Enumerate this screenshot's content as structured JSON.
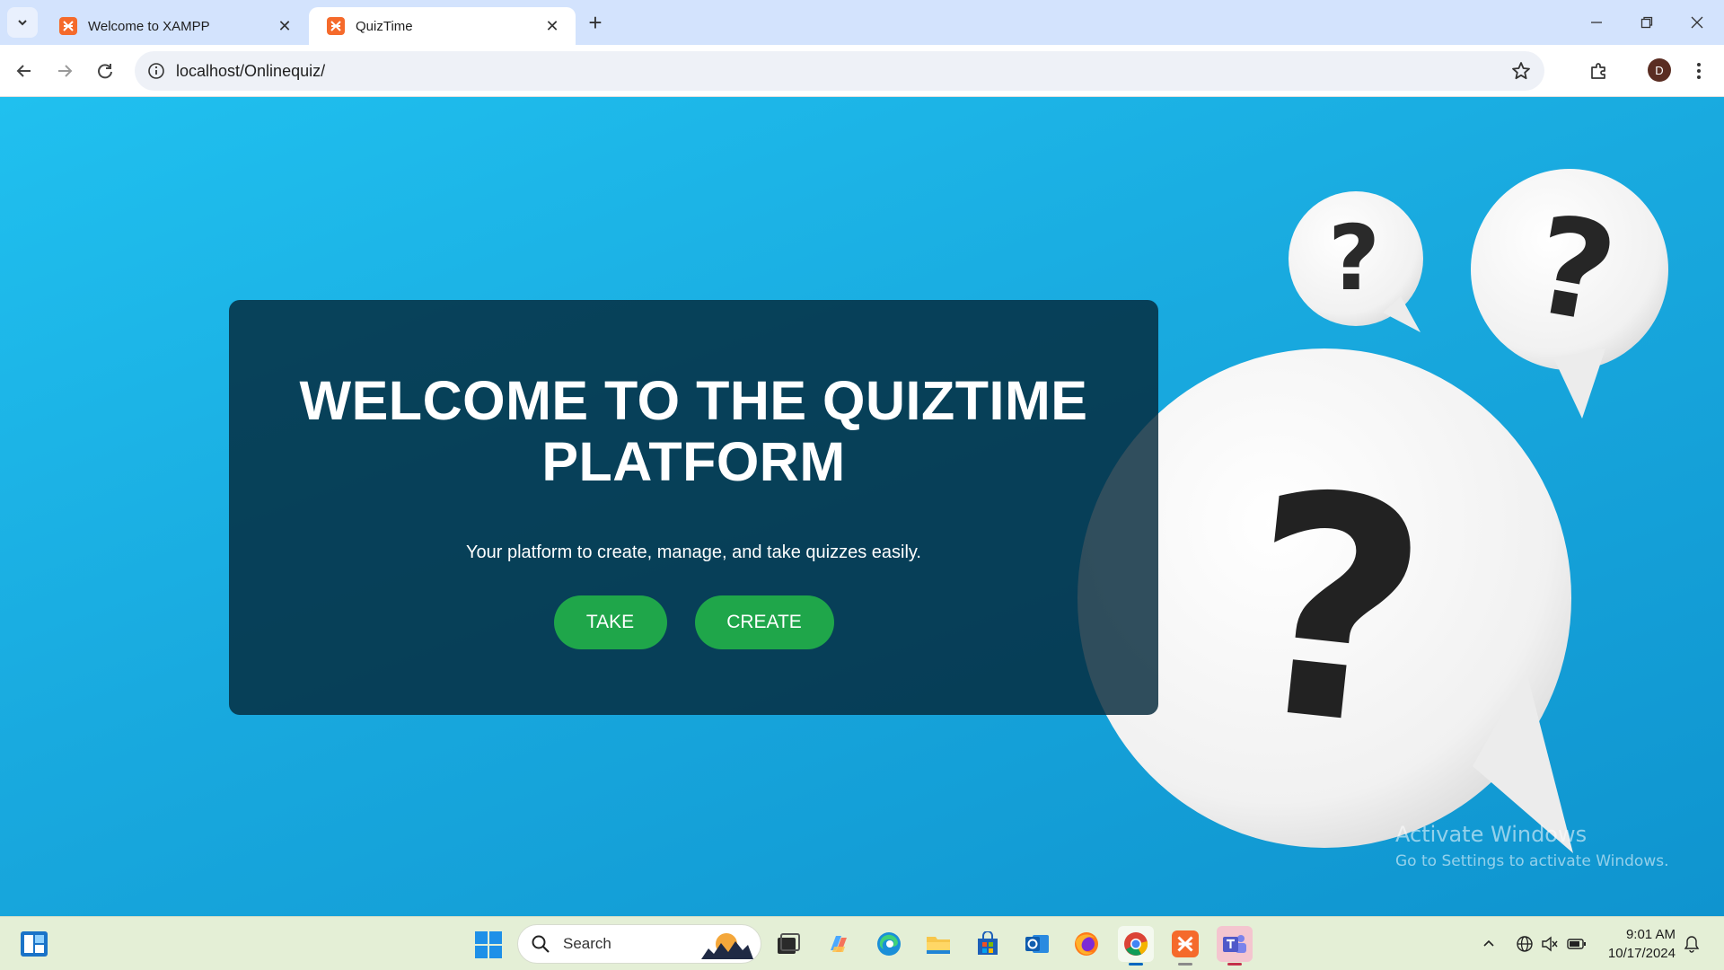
{
  "browser": {
    "tabs": [
      {
        "title": "Welcome to XAMPP",
        "active": false,
        "favicon": "xampp-icon"
      },
      {
        "title": "QuizTime",
        "active": true,
        "favicon": "xampp-icon"
      }
    ],
    "url": "localhost/Onlinequiz/",
    "profile_initial": "D"
  },
  "page": {
    "title": "WELCOME TO THE QUIZTIME PLATFORM",
    "subtitle": "Your platform to create, manage, and take quizzes easily.",
    "buttons": {
      "take": "TAKE",
      "create": "CREATE"
    },
    "button_color": "#1fa64a",
    "background_color": "#19aadf",
    "background_art": "question-mark-speech-bubbles"
  },
  "watermark": {
    "line1": "Activate Windows",
    "line2": "Go to Settings to activate Windows."
  },
  "taskbar": {
    "search_label": "Search",
    "apps": [
      "task-view-icon",
      "copilot-icon",
      "edge-icon",
      "file-explorer-icon",
      "store-icon",
      "outlook-icon",
      "firefox-icon",
      "chrome-icon",
      "xampp-icon",
      "teams-icon"
    ],
    "time": "9:01 AM",
    "date": "10/17/2024"
  }
}
